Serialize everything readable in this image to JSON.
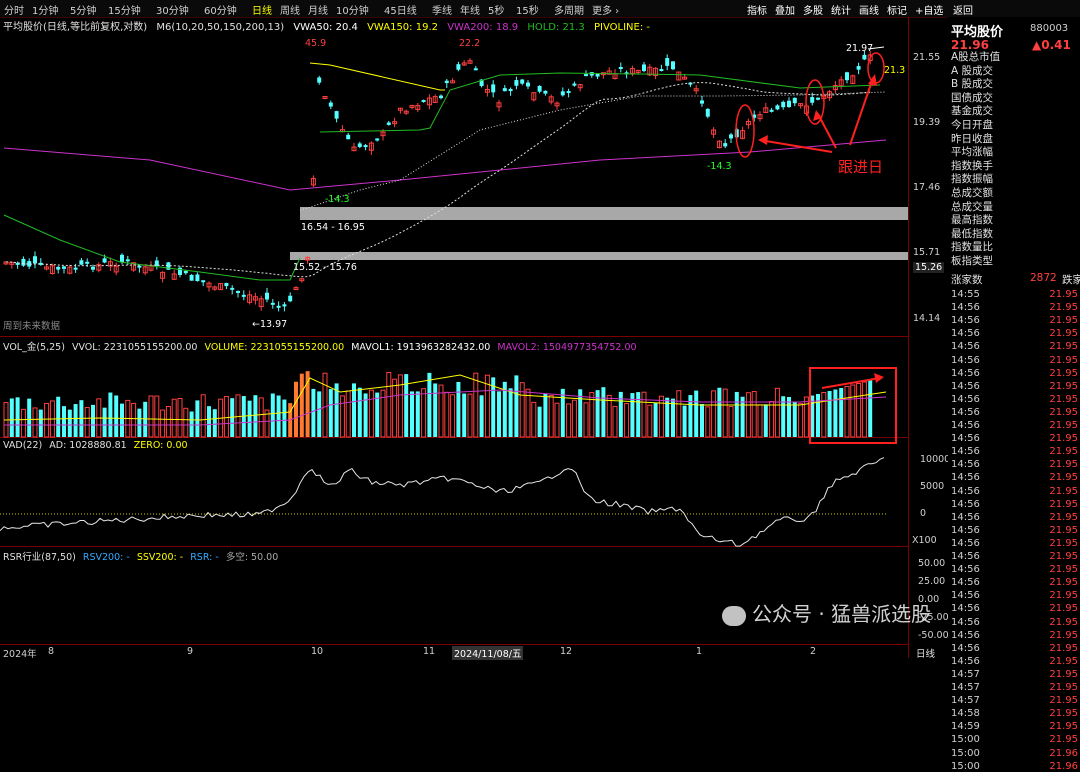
{
  "toolbar": {
    "periods": [
      "分时",
      "1分钟",
      "5分钟",
      "15分钟",
      "30分钟",
      "60分钟",
      "日线",
      "周线",
      "月线",
      "10分钟",
      "45日线",
      "季线",
      "年线",
      "5秒",
      "15秒",
      "多周期",
      "更多 ›"
    ],
    "active_period": "日线",
    "buttons": [
      "指标",
      "叠加",
      "多股",
      "统计",
      "画线",
      "标记",
      "+自选",
      "返回"
    ]
  },
  "header": {
    "title": "平均股价",
    "code": "880003",
    "price": "21.96",
    "change": "▲0.41"
  },
  "main_legend": {
    "name": "平均股价(日线,等比前复权,对数)",
    "ma": "M6(10,20,50,150,200,13)",
    "vwa50": "VWA50: 20.4",
    "vwa150": "VWA150: 19.2",
    "vwa200": "VWA200: 18.9",
    "hold": "HOLD: 21.3",
    "pivoline": "PIVOLINE: -"
  },
  "price_axis": [
    "21.55",
    "19.39",
    "17.46",
    "15.71",
    "14.14"
  ],
  "price_axis_current": "15.26",
  "annotations": {
    "high1": "45.9",
    "high2": "22.2",
    "high3": "21.97",
    "low1": "-14.3",
    "low2": "-14.3",
    "low3": "13.97",
    "zone1": "16.54 - 16.95",
    "zone2": "15.52 - 15.76",
    "hold_mark": "21.3",
    "note": "跟进日",
    "future": "周到未来数据"
  },
  "vol_legend": {
    "name": "VOL_金(5,25)",
    "vvol": "VVOL: 2231055155200.00",
    "volume": "VOLUME: 2231055155200.00",
    "mavol1": "MAVOL1: 1913963282432.00",
    "mavol2": "MAVOL2: 1504977354752.00"
  },
  "vad_legend": {
    "name": "VAD(22)",
    "ad": "AD: 1028880.81",
    "zero": "ZERO: 0.00"
  },
  "vad_axis": [
    "10000",
    "5000",
    "0",
    "X100"
  ],
  "rsr_legend": {
    "name": "RSR行业(87,50)",
    "rsv": "RSV200: -",
    "ssv": "SSV200: -",
    "rsr": "RSR: -",
    "dk": "多空: 50.00"
  },
  "rsr_axis": [
    "50.00",
    "25.00",
    "0.00",
    "-25.00",
    "-50.00"
  ],
  "date_axis": [
    "2024年",
    "8",
    "9",
    "10",
    "11",
    "2024/11/08/五",
    "12",
    "1",
    "2"
  ],
  "bottom_right_tab": "日线",
  "side_panel": {
    "items": [
      "A股总市值",
      "A 股成交",
      "B 股成交",
      "国债成交",
      "基金成交",
      "今日开盘",
      "昨日收盘",
      "平均涨幅",
      "指数换手",
      "指数振幅",
      "总成交额",
      "总成交量",
      "最高指数",
      "最低指数",
      "指数量比",
      "板指类型"
    ],
    "up_label": "涨家数",
    "up_value": "2872",
    "down_label": "跌家",
    "ticks": [
      {
        "t": "14:55",
        "p": "21.95"
      },
      {
        "t": "14:56",
        "p": "21.95"
      },
      {
        "t": "14:56",
        "p": "21.95"
      },
      {
        "t": "14:56",
        "p": "21.95"
      },
      {
        "t": "14:56",
        "p": "21.95"
      },
      {
        "t": "14:56",
        "p": "21.95"
      },
      {
        "t": "14:56",
        "p": "21.95"
      },
      {
        "t": "14:56",
        "p": "21.95"
      },
      {
        "t": "14:56",
        "p": "21.95"
      },
      {
        "t": "14:56",
        "p": "21.95"
      },
      {
        "t": "14:56",
        "p": "21.95"
      },
      {
        "t": "14:56",
        "p": "21.95"
      },
      {
        "t": "14:56",
        "p": "21.95"
      },
      {
        "t": "14:56",
        "p": "21.95"
      },
      {
        "t": "14:56",
        "p": "21.95"
      },
      {
        "t": "14:56",
        "p": "21.95"
      },
      {
        "t": "14:56",
        "p": "21.95"
      },
      {
        "t": "14:56",
        "p": "21.95"
      },
      {
        "t": "14:56",
        "p": "21.95"
      },
      {
        "t": "14:56",
        "p": "21.95"
      },
      {
        "t": "14:56",
        "p": "21.95"
      },
      {
        "t": "14:56",
        "p": "21.95"
      },
      {
        "t": "14:56",
        "p": "21.95"
      },
      {
        "t": "14:56",
        "p": "21.95"
      },
      {
        "t": "14:56",
        "p": "21.95"
      },
      {
        "t": "14:56",
        "p": "21.95"
      },
      {
        "t": "14:56",
        "p": "21.95"
      },
      {
        "t": "14:56",
        "p": "21.95"
      },
      {
        "t": "14:56",
        "p": "21.95"
      },
      {
        "t": "14:57",
        "p": "21.95"
      },
      {
        "t": "14:57",
        "p": "21.95"
      },
      {
        "t": "14:57",
        "p": "21.95"
      },
      {
        "t": "14:58",
        "p": "21.95"
      },
      {
        "t": "14:59",
        "p": "21.95"
      },
      {
        "t": "15:00",
        "p": "21.95"
      },
      {
        "t": "15:00",
        "p": "21.96"
      },
      {
        "t": "15:00",
        "p": "21.96"
      }
    ]
  },
  "watermark": "公众号 · 猛兽派选股",
  "colors": {
    "up": "#ff4040",
    "down": "#54ffff",
    "ma_white": "#e0e0e0",
    "vwa150": "#ffff00",
    "vwa200": "#cc33cc",
    "hold": "#22bb22",
    "annotation": "#ff2020"
  }
}
